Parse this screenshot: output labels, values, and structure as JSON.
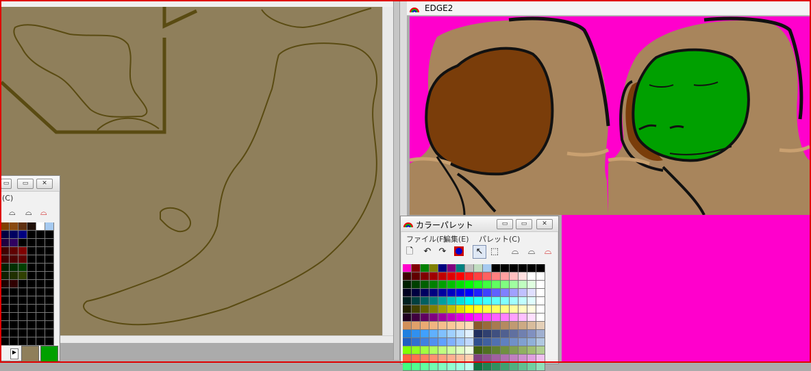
{
  "edge2_window": {
    "title": "EDGE2"
  },
  "palette_window": {
    "title": "カラーパレット",
    "menus": [
      {
        "label": "ファイル(F)"
      },
      {
        "label": "編集(E)"
      },
      {
        "label": "パレット(C)"
      }
    ],
    "buttons": {
      "minimize": "▭",
      "maximize": "▭",
      "close": "✕"
    }
  },
  "small_palette_window": {
    "menu_partial": "(C)",
    "current_colors": [
      "#8f7f5b",
      "#00a000"
    ]
  },
  "colors": {
    "canvas_bg_left": "#8f7f5b",
    "outline_dark": "#5a4b12",
    "magenta_bg": "#ff00cc",
    "skin": "#a8855c",
    "brown": "#7a3d0a",
    "green": "#00a000"
  },
  "palette_grid": [
    [
      "#ff00cc",
      "#800000",
      "#008000",
      "#808000",
      "#000080",
      "#800080",
      "#008080",
      "#c0c0c0",
      "#c0dcc0",
      "#a6caf0",
      "#000000",
      "#000000",
      "#000000",
      "#000000",
      "#000000",
      "#000000"
    ],
    [
      "#400000",
      "#600000",
      "#800000",
      "#a00000",
      "#c00000",
      "#e00000",
      "#ff0000",
      "#ff2020",
      "#ff4040",
      "#ff6060",
      "#ff8080",
      "#ffa0a0",
      "#ffc0c0",
      "#ffe0e0",
      "#ffffff",
      "#ffffff"
    ],
    [
      "#002000",
      "#004000",
      "#006000",
      "#008000",
      "#00a000",
      "#00c000",
      "#00e000",
      "#00ff00",
      "#20ff20",
      "#40ff40",
      "#60ff60",
      "#80ff80",
      "#a0ffa0",
      "#c0ffc0",
      "#e0ffe0",
      "#ffffff"
    ],
    [
      "#000020",
      "#000040",
      "#000060",
      "#000080",
      "#0000a0",
      "#0000c0",
      "#0000e0",
      "#0000ff",
      "#2020ff",
      "#4040ff",
      "#6060ff",
      "#8080ff",
      "#a0a0ff",
      "#c0c0ff",
      "#e0e0ff",
      "#ffffff"
    ],
    [
      "#002020",
      "#004040",
      "#006060",
      "#008080",
      "#00a0a0",
      "#00c0c0",
      "#00e0e0",
      "#00ffff",
      "#20ffff",
      "#40ffff",
      "#60ffff",
      "#80ffff",
      "#a0ffff",
      "#c0ffff",
      "#e0ffff",
      "#ffffff"
    ],
    [
      "#202000",
      "#404000",
      "#606000",
      "#808000",
      "#a0a000",
      "#c0c000",
      "#e0e000",
      "#ffff00",
      "#ffff20",
      "#ffff40",
      "#ffff60",
      "#ffff80",
      "#ffffa0",
      "#ffffc0",
      "#ffffe0",
      "#ffffff"
    ],
    [
      "#200020",
      "#400040",
      "#600060",
      "#800080",
      "#a000a0",
      "#c000c0",
      "#e000e0",
      "#ff00ff",
      "#ff20ff",
      "#ff40ff",
      "#ff60ff",
      "#ff80ff",
      "#ffa0ff",
      "#ffc0ff",
      "#ffe0ff",
      "#ffffff"
    ],
    [
      "#d2905a",
      "#e0a06a",
      "#eaaa72",
      "#f0b480",
      "#f6be8c",
      "#fac898",
      "#fdd2a8",
      "#ffdcb8",
      "#8a5a2a",
      "#9a6a3a",
      "#a87a50",
      "#b48a60",
      "#c09a72",
      "#ccaa84",
      "#d8bc9c",
      "#e4d0b8"
    ],
    [
      "#2080e0",
      "#3090f0",
      "#40a0ff",
      "#60b0ff",
      "#80c0ff",
      "#a0d0ff",
      "#c0e0ff",
      "#e0f0ff",
      "#203060",
      "#304070",
      "#405080",
      "#506090",
      "#6070a0",
      "#7080b0",
      "#8090c0",
      "#a0b0d0"
    ],
    [
      "#2060c0",
      "#3070d0",
      "#4080e0",
      "#5090f0",
      "#60a0ff",
      "#80b0ff",
      "#a0c8ff",
      "#c0d8ff",
      "#305090",
      "#4060a0",
      "#5070b0",
      "#6080c0",
      "#7090c8",
      "#80a0d0",
      "#90b0d8",
      "#b0c8e0"
    ],
    [
      "#80ff00",
      "#90ff20",
      "#a0ff40",
      "#b0ff60",
      "#c0ff80",
      "#d0ffa0",
      "#e0ffc0",
      "#f0ffe0",
      "#406010",
      "#507020",
      "#608030",
      "#709040",
      "#80a050",
      "#90b060",
      "#a0c070",
      "#b0d090"
    ],
    [
      "#ff6040",
      "#ff7050",
      "#ff8060",
      "#ff9070",
      "#ffa080",
      "#ffb090",
      "#ffc0a0",
      "#ffd0b0",
      "#804080",
      "#905090",
      "#a060a0",
      "#b070b0",
      "#c080c0",
      "#d090d0",
      "#e0a0e0",
      "#f0c0f0"
    ],
    [
      "#40ff80",
      "#50ff90",
      "#60ffa0",
      "#70ffb0",
      "#80ffc0",
      "#90ffd0",
      "#a0ffe0",
      "#c0fff0",
      "#107040",
      "#208050",
      "#309060",
      "#40a070",
      "#50b080",
      "#60c090",
      "#70d0a0",
      "#90e0b8"
    ]
  ],
  "small_palette_grid": [
    [
      "#804000",
      "#8a4a10",
      "#603010",
      "#201008",
      "#ffffff",
      "#a6caf0"
    ],
    [
      "#000040",
      "#000060",
      "#000080",
      "#000000",
      "#000000",
      "#000000"
    ],
    [
      "#200040",
      "#300060",
      "#000000",
      "#000000",
      "#000000",
      "#000000"
    ],
    [
      "#400000",
      "#600000",
      "#800000",
      "#000000",
      "#000000",
      "#000000"
    ],
    [
      "#400000",
      "#500000",
      "#600000",
      "#000000",
      "#000000",
      "#000000"
    ],
    [
      "#002000",
      "#003000",
      "#004000",
      "#000000",
      "#000000",
      "#000000"
    ],
    [
      "#102000",
      "#203000",
      "#304000",
      "#000000",
      "#000000",
      "#000000"
    ],
    [
      "#200000",
      "#300000",
      "#000000",
      "#000000",
      "#000000",
      "#000000"
    ],
    [
      "#000000",
      "#000000",
      "#000000",
      "#000000",
      "#000000",
      "#000000"
    ],
    [
      "#000000",
      "#000000",
      "#000000",
      "#000000",
      "#000000",
      "#000000"
    ],
    [
      "#000000",
      "#000000",
      "#000000",
      "#000000",
      "#000000",
      "#000000"
    ],
    [
      "#000000",
      "#000000",
      "#000000",
      "#000000",
      "#000000",
      "#000000"
    ],
    [
      "#000000",
      "#000000",
      "#000000",
      "#000000",
      "#000000",
      "#000000"
    ],
    [
      "#000000",
      "#000000",
      "#000000",
      "#000000",
      "#000000",
      "#000000"
    ],
    [
      "#000000",
      "#000000",
      "#000000",
      "#000000",
      "#000000",
      "#000000"
    ]
  ]
}
